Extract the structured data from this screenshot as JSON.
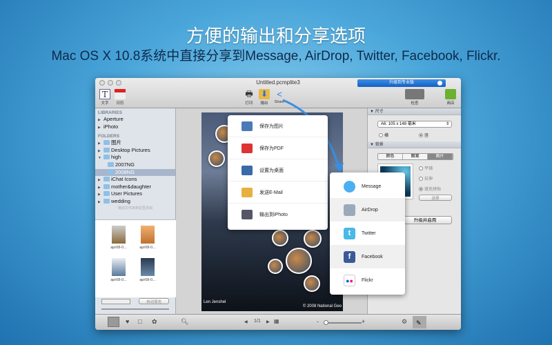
{
  "headline": "方便的输出和分享选项",
  "subheadline": "Mac OS X 10.8系统中直接分享到Message, AirDrop, Twitter, Facebook, Flickr.",
  "window": {
    "title": "Untitled.pcmplite3",
    "upgrade_label": "升级到专业版"
  },
  "toolbar": {
    "text": "文字",
    "calendar": "日历",
    "print": "打印",
    "export": "输出",
    "share": "Share",
    "layout": "检查",
    "store": "商店"
  },
  "sidebar": {
    "libraries_header": "LIBRARIES",
    "libraries": [
      "Aperture",
      "iPhoto"
    ],
    "folders_header": "FOLDERS",
    "folders": [
      "图片",
      "Desktop Pictures",
      "high",
      "2007NG",
      "2008NG",
      "iChat Icons",
      "mother&daughter",
      "User Pictures",
      "wedding"
    ],
    "hint": "拖动文件夹到这里添加",
    "thumb_labels": [
      "apr08-0...",
      "apr08-0...",
      "apr08-0...",
      "apr08-0..."
    ],
    "auto_fill": "自动填充"
  },
  "photo": {
    "credit_left": "Len Jenshel",
    "credit_right": "© 2008 National Geo"
  },
  "export_menu": [
    "保存为图片",
    "保存为PDF",
    "设置为桌面",
    "发送E-Mail",
    "输出到iPhoto"
  ],
  "share_menu": [
    "Message",
    "AirDrop",
    "Twitter",
    "Facebook",
    "Flickr"
  ],
  "inspector": {
    "size_header": "尺寸",
    "size_value": "A6: 105 x 148 毫米",
    "landscape": "横",
    "portrait": "竖",
    "bg_header": "背景",
    "bg_tabs": [
      "颜色",
      "图案",
      "图片"
    ],
    "fill_options": [
      "平铺",
      "拉伸",
      "填充拼贴"
    ],
    "choose": "选择",
    "upgrade_enable": "升级并启用"
  },
  "bottombar": {
    "page": "1/1"
  }
}
